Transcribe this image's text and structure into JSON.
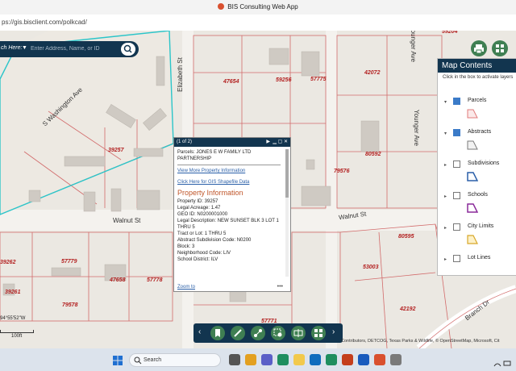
{
  "window": {
    "title": "BIS Consulting Web App"
  },
  "address_bar": {
    "url": "ps://gis.bisclient.com/polkcad/"
  },
  "search": {
    "label": "ch Here:",
    "placeholder": "Enter Address, Name, or ID"
  },
  "streets": {
    "washington": "S Washington Ave",
    "elizabeth": "Elizabeth St",
    "walnut_west": "Walnut St",
    "walnut_east": "Walnut St",
    "younger_top": "Younger Ave",
    "younger_mid": "Younger Ave",
    "branch": "Branch Dr"
  },
  "lot_numbers": {
    "l59204": "59204",
    "l47654": "47654",
    "l59256": "59256",
    "l57775": "57775",
    "l42072": "42072",
    "l39257": "39257",
    "l80592": "80592",
    "l79576": "79576",
    "l39262": "39262",
    "l57779": "57779",
    "l47658": "47658",
    "l57778": "57778",
    "l39261": "39261",
    "l79578": "79578",
    "l80595": "80595",
    "l53003": "53003",
    "l42192": "42192",
    "l57771": "57771"
  },
  "map_contents": {
    "title": "Map Contents",
    "instruction": "Click in the box to activate layers",
    "layers": [
      {
        "name": "Parcels",
        "checked": true
      },
      {
        "name": "Abstracts",
        "checked": true
      },
      {
        "name": "Subdivisions",
        "checked": false
      },
      {
        "name": "Schools",
        "checked": false
      },
      {
        "name": "City Limits",
        "checked": false
      },
      {
        "name": "Lot Lines",
        "checked": false
      }
    ],
    "colors": {
      "header": "#12354f",
      "parcels": "#e07a7a",
      "abstracts": "#7a7a7a",
      "subdivisions": "#2a5fa8",
      "schools": "#8a2a9a",
      "city_limits": "#d8a82a"
    }
  },
  "popup": {
    "counter": "(1 of 2)",
    "owner": "Parcels: JONES E W FAMILY LTD PARTNERSHIP",
    "link_info": "View More Property Information",
    "link_shapefile": "Click Here for GIS Shapefile Data",
    "section_title": "Property Information",
    "fields": [
      "Property ID: 39257",
      "Legal Acreage: 1.47",
      "GEO ID: N0200001000",
      "Legal Description: NEW SUNSET BLK 3 LOT 1 THRU 5",
      "Tract or Lot: 1 THRU 5",
      "Abstract Subdivision Code: N0200",
      "Block: 3",
      "Neighborhood Code: LIV",
      "School District: ILV"
    ],
    "zoom_to": "Zoom to",
    "more": "•••"
  },
  "coordinates": "94°55'52\"W",
  "scale": "100ft",
  "attribution": "Contributors, DETCOG, Texas Parks & Wildlife, © OpenStreetMap, Microsoft, Cit",
  "taskbar": {
    "search_placeholder": "Search"
  }
}
